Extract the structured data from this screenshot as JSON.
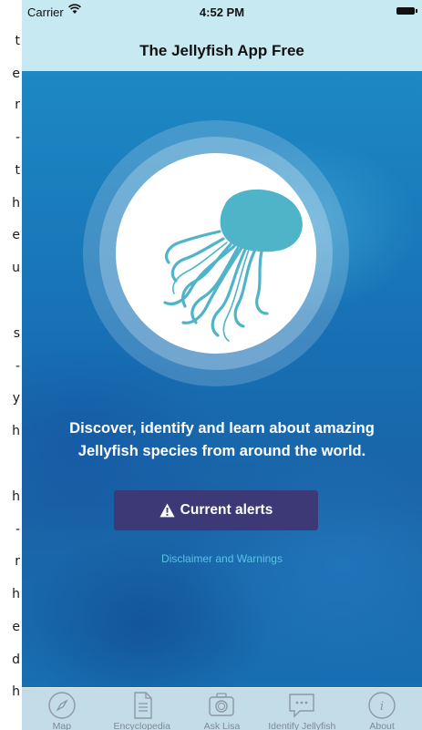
{
  "left_edge_text": [
    {
      "char": "t",
      "row": 1
    },
    {
      "char": "e",
      "row": 2
    },
    {
      "char": "r",
      "row": 3
    },
    {
      "char": "-",
      "row": 4
    },
    {
      "char": "t",
      "row": 5
    },
    {
      "char": "h",
      "row": 6
    },
    {
      "char": "e",
      "row": 7
    },
    {
      "char": "u",
      "row": 8
    },
    {
      "char": "s",
      "row": 10
    },
    {
      "char": "-",
      "row": 11
    },
    {
      "char": "y",
      "row": 12
    },
    {
      "char": "h",
      "row": 13
    },
    {
      "char": "h",
      "row": 15
    },
    {
      "char": "-",
      "row": 16
    },
    {
      "char": "r",
      "row": 17
    },
    {
      "char": "h",
      "row": 18
    },
    {
      "char": "e",
      "row": 19
    },
    {
      "char": "d",
      "row": 20
    },
    {
      "char": "h",
      "row": 21
    }
  ],
  "status_bar": {
    "carrier": "Carrier",
    "time": "4:52 PM"
  },
  "nav": {
    "title": "The Jellyfish App Free"
  },
  "main": {
    "tagline_line1": "Discover, identify and learn about amazing",
    "tagline_line2": "Jellyfish species from around the world.",
    "alerts_label": "Current alerts",
    "disclaimer_label": "Disclaimer and Warnings"
  },
  "tabs": [
    {
      "label": "Map",
      "icon": "compass-icon"
    },
    {
      "label": "Encyclopedia",
      "icon": "document-icon"
    },
    {
      "label": "Ask Lisa",
      "icon": "camera-icon"
    },
    {
      "label": "Identify Jellyfish",
      "icon": "chat-bubble-icon"
    },
    {
      "label": "About",
      "icon": "info-icon"
    }
  ],
  "colors": {
    "nav_background": "#c7e9f1",
    "ocean": "#1a7fb8",
    "logo_teal": "#4fb4c8",
    "button": "#3d3876",
    "disclaimer_link": "#59c3e6",
    "tab_icon": "#8c99a3"
  }
}
